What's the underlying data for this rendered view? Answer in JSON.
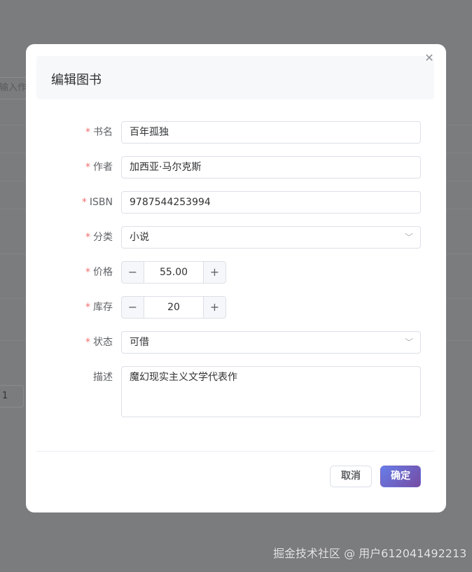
{
  "background": {
    "search_placeholder": "输入作者",
    "page_number": "1"
  },
  "dialog": {
    "title": "编辑图书",
    "close_icon": "close-icon",
    "fields": {
      "title": {
        "label": "书名",
        "required": "*",
        "value": "百年孤独"
      },
      "author": {
        "label": "作者",
        "required": "*",
        "value": "加西亚·马尔克斯"
      },
      "isbn": {
        "label": "ISBN",
        "required": "*",
        "value": "9787544253994"
      },
      "category": {
        "label": "分类",
        "required": "*",
        "value": "小说"
      },
      "price": {
        "label": "价格",
        "required": "*",
        "value": "55.00",
        "minus": "−",
        "plus": "+"
      },
      "stock": {
        "label": "库存",
        "required": "*",
        "value": "20",
        "minus": "−",
        "plus": "+"
      },
      "status": {
        "label": "状态",
        "required": "*",
        "value": "可借"
      },
      "description": {
        "label": "描述",
        "value": "魔幻现实主义文学代表作"
      }
    },
    "cancel_label": "取消",
    "confirm_label": "确定"
  },
  "watermark": "掘金技术社区 @ 用户612041492213",
  "colors": {
    "accent_start": "#667eea",
    "accent_end": "#764ba2",
    "required": "#f56c6c"
  }
}
